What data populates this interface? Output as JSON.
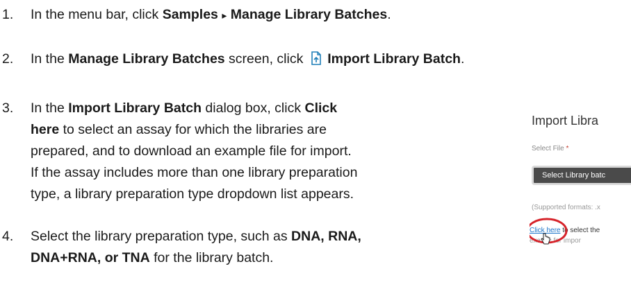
{
  "steps": [
    {
      "number": "1.",
      "pre": "In the menu bar, click ",
      "bold1": "Samples",
      "arrow": "▸",
      "bold2": "Manage Library Batches",
      "post": "."
    },
    {
      "number": "2.",
      "pre": "In the ",
      "bold1": "Manage Library Batches",
      "mid": " screen, click ",
      "bold2": "Import Library Batch",
      "post": ".",
      "icon": "import-file-icon"
    },
    {
      "number": "3.",
      "line1_pre": "In the ",
      "line1_bold1": "Import Library Batch",
      "line1_mid": " dialog box, click ",
      "line1_bold2": "Click",
      "line2_bold": "here",
      "line2_post": " to select an assay for which the libraries are",
      "line3": "prepared, and to download an example file for import.",
      "line4": "If the assay includes more than one library preparation",
      "line5": "type, a library preparation type dropdown list appears."
    },
    {
      "number": "4.",
      "line1_pre": "Select the library preparation type, such as ",
      "line1_bold": "DNA, RNA,",
      "line2_bold": "DNA+RNA, or TNA",
      "line2_post": " for the library batch."
    }
  ],
  "inset": {
    "title": "Import Libra",
    "select_label": "Select File",
    "required_mark": "*",
    "button_label": "Select Library batc",
    "formats": "(Supported formats: .x",
    "link_text": "Click here",
    "link_after": " to select the",
    "line2": "exa      file for impor",
    "circle_color": "#d6232a",
    "link_color": "#1a73c9"
  }
}
